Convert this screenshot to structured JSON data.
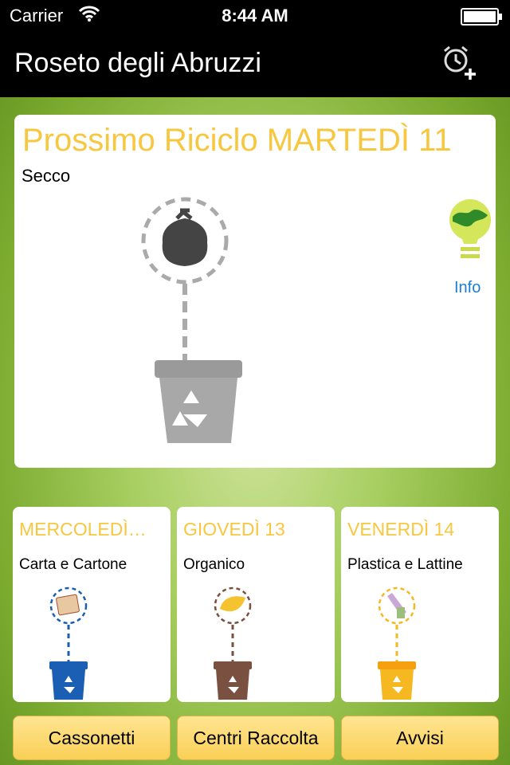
{
  "status_bar": {
    "carrier": "Carrier",
    "time": "8:44 AM"
  },
  "nav": {
    "title": "Roseto degli Abruzzi",
    "alarm_icon": "alarm-add-icon"
  },
  "next": {
    "day": "Prossimo Riciclo MARTEDÌ 11",
    "type": "Secco",
    "info_label": "Info",
    "illustration": "black-bag-grey-bin-icon"
  },
  "upcoming": [
    {
      "day": "MERCOLEDÌ…",
      "type": "Carta e Cartone",
      "bin_color": "#1a5fb4",
      "icon": "paper-cardboard-icon"
    },
    {
      "day": "GIOVEDÌ 13",
      "type": "Organico",
      "bin_color": "#7a5140",
      "icon": "organic-leaf-icon"
    },
    {
      "day": "VENERDÌ 14",
      "type": "Plastica e Lattine",
      "bin_color": "#f5b820",
      "icon": "plastic-cans-icon"
    }
  ],
  "buttons": {
    "bins": "Cassonetti",
    "centers": "Centri Raccolta",
    "notices": "Avvisi"
  },
  "colors": {
    "accent": "#f7c73f",
    "link": "#1a7ed6",
    "button": "#f9cf55"
  }
}
